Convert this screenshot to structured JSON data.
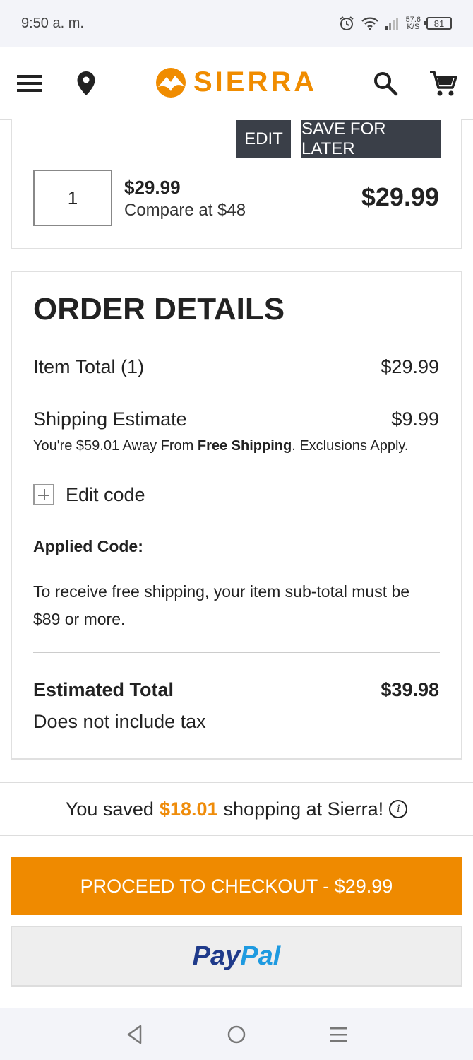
{
  "status": {
    "time": "9:50 a. m.",
    "speed": "57.6",
    "speed_unit": "K/S",
    "battery": "81"
  },
  "header": {
    "brand": "SIERRA",
    "icons": [
      "menu-icon",
      "location-icon",
      "search-icon",
      "cart-icon"
    ]
  },
  "item": {
    "edit_label": "EDIT",
    "save_label": "SAVE FOR LATER",
    "quantity": "1",
    "unit_price": "$29.99",
    "compare": "Compare at $48",
    "line_total": "$29.99"
  },
  "order": {
    "title": "ORDER DETAILS",
    "item_total_label": "Item Total (1)",
    "item_total_value": "$29.99",
    "shipping_label": "Shipping Estimate",
    "shipping_value": "$9.99",
    "free_ship_prefix": "You're $59.01 Away From ",
    "free_ship_bold": "Free Shipping",
    "free_ship_suffix": ". Exclusions Apply.",
    "edit_code": "Edit code",
    "applied_code_label": "Applied Code:",
    "code_message": "To receive free shipping, your item sub-total must be $89 or more.",
    "estimated_total_label": "Estimated Total",
    "estimated_total_value": "$39.98",
    "tax_note": "Does not include tax"
  },
  "savings": {
    "prefix": "You saved",
    "amount": "$18.01",
    "suffix": "shopping at Sierra!",
    "info": "i"
  },
  "checkout_label": "PROCEED TO CHECKOUT - $29.99",
  "paypal": {
    "part1": "Pay",
    "part2": "Pal"
  },
  "colors": {
    "accent": "#ef8a00",
    "dark_button": "#3a3f48",
    "paypal_dark": "#1f3a8a",
    "paypal_light": "#1e9ae0"
  }
}
